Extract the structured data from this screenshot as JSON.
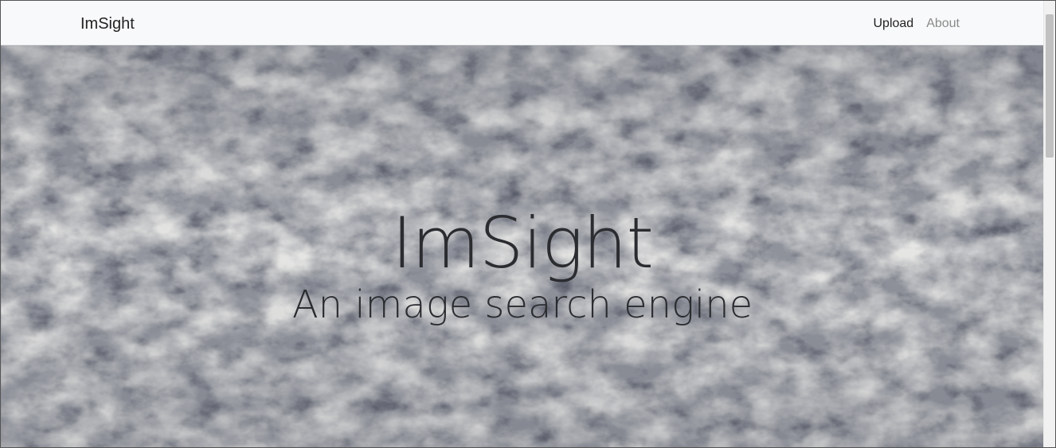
{
  "navbar": {
    "brand": "ImSight",
    "links": [
      {
        "label": "Upload",
        "state": "active"
      },
      {
        "label": "About",
        "state": "inactive"
      }
    ]
  },
  "hero": {
    "title": "ImSight",
    "subtitle": "An image search engine",
    "background": "cloud texture"
  },
  "colors": {
    "navbar_bg": "#f8f9fa",
    "hero_text": "#2a2c30",
    "link_active": "#222222",
    "link_muted": "#8a8a8a"
  }
}
